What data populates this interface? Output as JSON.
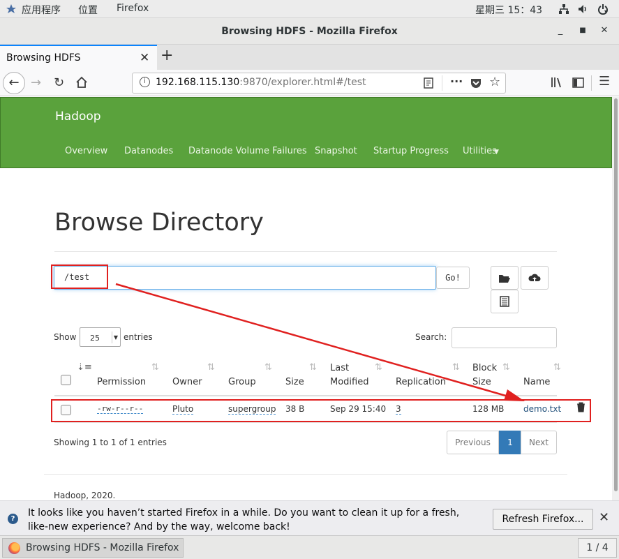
{
  "topbar": {
    "apps_label": "应用程序",
    "places_label": "位置",
    "firefox_label": "Firefox",
    "clock": "星期三 15：43"
  },
  "window": {
    "title": "Browsing HDFS - Mozilla Firefox"
  },
  "tab": {
    "label": "Browsing HDFS"
  },
  "url": {
    "host": "192.168.115.130",
    "rest": ":9870/explorer.html#/test"
  },
  "hadoop": {
    "brand": "Hadoop",
    "nav": [
      "Overview",
      "Datanodes",
      "Datanode Volume Failures",
      "Snapshot",
      "Startup Progress",
      "Utilities"
    ],
    "page_title": "Browse Directory",
    "path_value": "/test",
    "go_label": "Go!",
    "show_label": "Show",
    "entries_value": "25",
    "entries_label": "entries",
    "search_label": "Search:",
    "columns": {
      "permission": "Permission",
      "owner": "Owner",
      "group": "Group",
      "size": "Size",
      "last": "Last",
      "modified": "Modified",
      "replication": "Replication",
      "block": "Block",
      "blocksize": "Size",
      "name": "Name"
    },
    "rows": [
      {
        "permission": "-rw-r--r--",
        "owner": "Pluto",
        "group": "supergroup",
        "size": "38 B",
        "modified": "Sep 29 15:40",
        "replication": "3",
        "blocksize": "128 MB",
        "name": "demo.txt"
      }
    ],
    "showing": "Showing 1 to 1 of 1 entries",
    "pager": {
      "previous": "Previous",
      "page": "1",
      "next": "Next"
    },
    "footer": "Hadoop, 2020."
  },
  "notification": {
    "message": "It looks like you haven’t started Firefox in a while. Do you want to clean it up for a fresh, like-new experience? And by the way, welcome back!",
    "button": "Refresh Firefox..."
  },
  "taskbar": {
    "task_label": "Browsing HDFS - Mozilla Firefox",
    "workspace": "1 / 4"
  },
  "annotation_color": "#e0201f"
}
